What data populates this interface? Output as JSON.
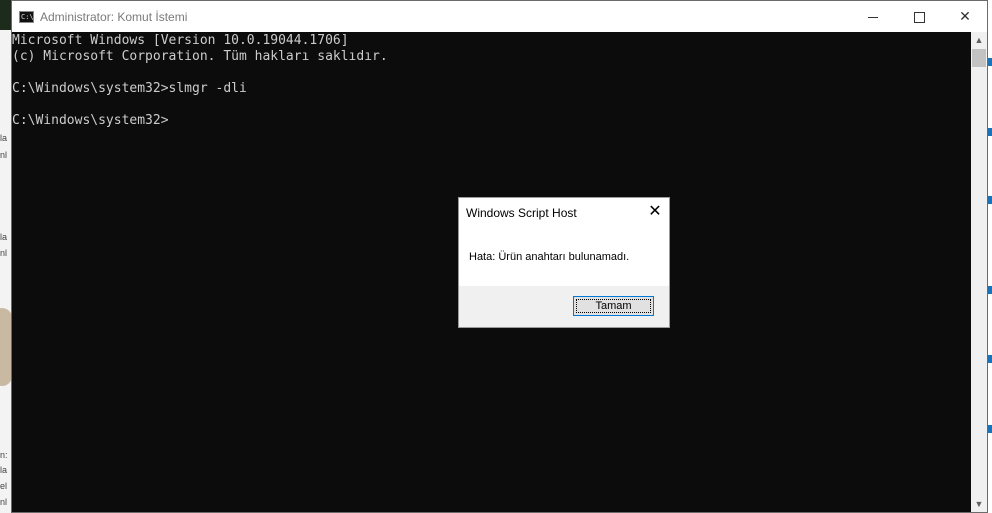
{
  "window": {
    "title": "Administrator: Komut İstemi",
    "icon": "cmd-icon",
    "icon_label": "C:\\.",
    "controls": {
      "minimize": "minimize-icon",
      "maximize": "maximize-icon",
      "close_glyph": "✕"
    }
  },
  "console": {
    "lines": [
      "Microsoft Windows [Version 10.0.19044.1706]",
      "(c) Microsoft Corporation. Tüm hakları saklıdır.",
      "",
      "C:\\Windows\\system32>slmgr -dli",
      "",
      "C:\\Windows\\system32>"
    ],
    "text_color": "#cccccc",
    "background": "#0c0c0c"
  },
  "scrollbar": {
    "up_glyph": "▲",
    "down_glyph": "▼"
  },
  "dialog": {
    "title": "Windows Script Host",
    "close_glyph": "✕",
    "message": "Hata: Ürün anahtarı bulunamadı.",
    "ok_label": "Tamam"
  },
  "background_fragments": {
    "left": [
      "la",
      "nl",
      "la",
      "nl",
      "n:",
      "la",
      "el",
      "nl"
    ],
    "right_link_color": "#1a73b8"
  }
}
